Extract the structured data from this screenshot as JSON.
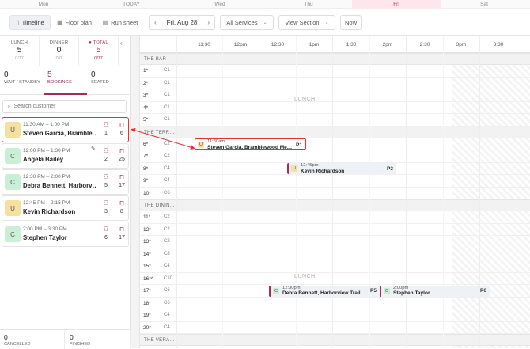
{
  "days": [
    {
      "label": "Mon"
    },
    {
      "label": "TODAY"
    },
    {
      "label": "Wed"
    },
    {
      "label": "Thu"
    },
    {
      "label": "Fri"
    },
    {
      "label": "Sat"
    }
  ],
  "toolbar": {
    "timeline": "Timeline",
    "floor_plan": "Floor plan",
    "run_sheet": "Run sheet",
    "prev": "‹",
    "date": "Fri, Aug 28",
    "next": "›",
    "services": "All Services",
    "section": "View Section",
    "now": "Now"
  },
  "stats": {
    "lunch": {
      "label": "LUNCH",
      "value": "5",
      "sub": "0/17"
    },
    "dinner": {
      "label": "DINNER",
      "value": "0",
      "sub": "0/0"
    },
    "total": {
      "label": "TOTAL",
      "value": "5",
      "sub": "0/17"
    }
  },
  "tabs": [
    {
      "value": "0",
      "label": "WAIT / STANDBY"
    },
    {
      "value": "5",
      "label": "BOOKINGS"
    },
    {
      "value": "0",
      "label": "SEATED"
    }
  ],
  "search": {
    "placeholder": "Search customer"
  },
  "bookings": [
    {
      "initial": "U",
      "time": "11:30 AM – 1:00 PM",
      "name": "Steven Garcia, Bramble…",
      "party": "1",
      "table": "6"
    },
    {
      "initial": "C",
      "time": "12:00 PM – 1:30 PM",
      "name": "Angela Bailey",
      "party": "2",
      "table": "25"
    },
    {
      "initial": "C",
      "time": "12:30 PM – 2:00 PM",
      "name": "Debra Bennett, Harborv…",
      "party": "5",
      "table": "17"
    },
    {
      "initial": "U",
      "time": "12:45 PM – 2:15 PM",
      "name": "Kevin Richardson",
      "party": "3",
      "table": "8"
    },
    {
      "initial": "C",
      "time": "2:00 PM – 3:30 PM",
      "name": "Stephen Taylor",
      "party": "6",
      "table": "17"
    }
  ],
  "bottom": {
    "cancelled": {
      "value": "0",
      "label": "CANCELLED"
    },
    "finished": {
      "value": "0",
      "label": "FINISHED"
    }
  },
  "timeline": {
    "ticks": [
      "11:30",
      "12pm",
      "12:30",
      "1pm",
      "1:30",
      "2pm",
      "2:30",
      "3pm",
      "3:30"
    ],
    "sections": [
      {
        "label": "THE BAR",
        "tables": [
          {
            "n": "1*",
            "c": "C1"
          },
          {
            "n": "2*",
            "c": "C1"
          },
          {
            "n": "3*",
            "c": "C1"
          },
          {
            "n": "4*",
            "c": "C1"
          },
          {
            "n": "5*",
            "c": "C1"
          }
        ]
      },
      {
        "label": "THE TERR…",
        "tables": [
          {
            "n": "6*",
            "c": "C2"
          },
          {
            "n": "7*",
            "c": "C2"
          },
          {
            "n": "8*",
            "c": "C4"
          },
          {
            "n": "9*",
            "c": "C4"
          },
          {
            "n": "10*",
            "c": "C6"
          }
        ]
      },
      {
        "label": "THE DININ…",
        "tables": [
          {
            "n": "11*",
            "c": "C2"
          },
          {
            "n": "12*",
            "c": "C2"
          },
          {
            "n": "13*",
            "c": "C2"
          },
          {
            "n": "14*",
            "c": "C8"
          },
          {
            "n": "15*",
            "c": "C4"
          },
          {
            "n": "16*^",
            "c": "C10"
          },
          {
            "n": "17*",
            "c": "C6"
          },
          {
            "n": "18*",
            "c": "C6"
          },
          {
            "n": "19*",
            "c": "C4"
          },
          {
            "n": "20*",
            "c": "C4"
          }
        ]
      },
      {
        "label": "THE VERA…",
        "tables": []
      }
    ],
    "service_label": "LUNCH",
    "reservations": [
      {
        "initial": "U",
        "time": "11:30am",
        "name": "Steven Garcia, Bramblewood Me…",
        "party": "P1"
      },
      {
        "initial": "U",
        "time": "12:45pm",
        "name": "Kevin Richardson",
        "party": "P3"
      },
      {
        "initial": "C",
        "time": "12:30pm",
        "name": "Debra Bennett, Harborview Trail…",
        "party": "P5"
      },
      {
        "initial": "C",
        "time": "2:00pm",
        "name": "Stephen Taylor",
        "party": "P6"
      }
    ]
  },
  "colors": {
    "accent": "#a52a5a",
    "selection": "#dd3333",
    "today_bg": "#fde7ec"
  }
}
